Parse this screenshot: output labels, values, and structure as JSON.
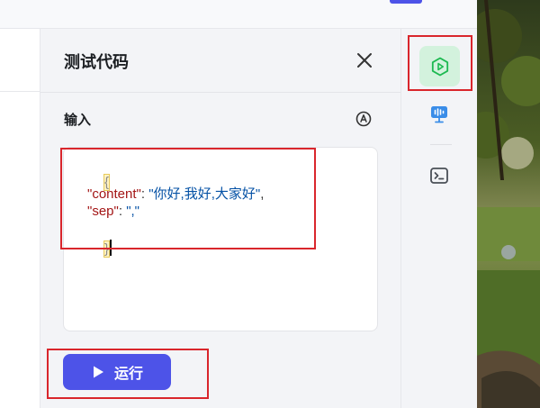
{
  "panel": {
    "title": "测试代码",
    "input_label": "输入",
    "run_label": "运行"
  },
  "editor": {
    "open_brace": "{",
    "line_content_key": "\"content\"",
    "line_content_colon": ": ",
    "line_content_value": "\"你好,我好,大家好\"",
    "line_content_comma": ",",
    "line_sep_key": "\"sep\"",
    "line_sep_colon": ": ",
    "line_sep_value": "\",\"",
    "close_brace": "}"
  },
  "colors": {
    "accent": "#4d53e8",
    "run_active_bg": "#d3f2dd",
    "run_active_icon": "#1cb950",
    "highlight": "#d9262c"
  },
  "icons": {
    "close": "close-icon",
    "ai": "ai-format-icon",
    "play": "play-icon",
    "sidebar_run": "run-test-icon",
    "sidebar_monitor": "monitor-icon",
    "sidebar_terminal": "terminal-icon"
  }
}
